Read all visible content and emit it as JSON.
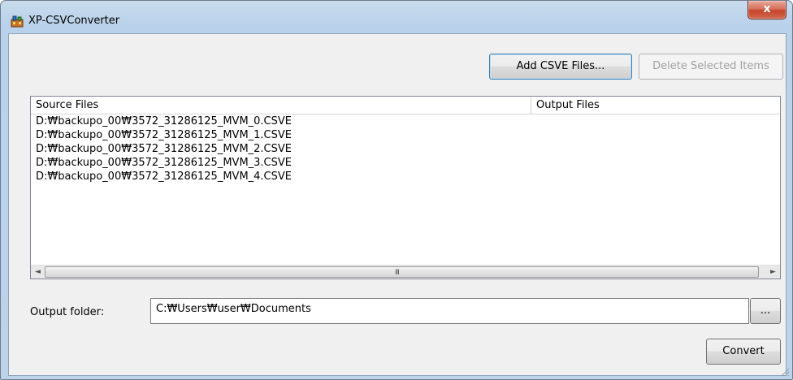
{
  "window": {
    "title": "XP-CSVConverter",
    "close_label": "x"
  },
  "toolbar": {
    "add_label": "Add CSVE Files...",
    "delete_label": "Delete Selected Items"
  },
  "list": {
    "columns": [
      "Source Files",
      "Output Files"
    ],
    "rows": [
      "D:₩backupo_00₩3572_31286125_MVM_0.CSVE",
      "D:₩backupo_00₩3572_31286125_MVM_1.CSVE",
      "D:₩backupo_00₩3572_31286125_MVM_2.CSVE",
      "D:₩backupo_00₩3572_31286125_MVM_3.CSVE",
      "D:₩backupo_00₩3572_31286125_MVM_4.CSVE"
    ],
    "scrollbar": {
      "left_arrow": "◄",
      "right_arrow": "►",
      "grip": "III"
    }
  },
  "output": {
    "label": "Output folder:",
    "value": "C:₩Users₩user₩Documents",
    "browse_label": "..."
  },
  "actions": {
    "convert_label": "Convert"
  },
  "icons": {
    "app": "app-icon",
    "close": "close-icon",
    "resize": "resize-grip-icon"
  }
}
